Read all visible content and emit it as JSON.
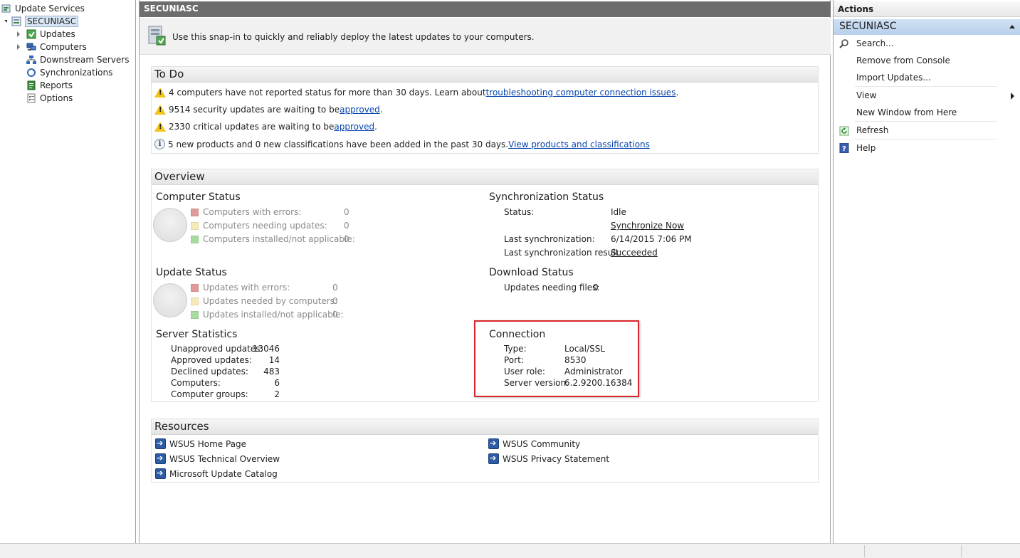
{
  "tree": {
    "root": "Update Services",
    "server": "SECUNIASC",
    "items": [
      {
        "label": "Updates",
        "icon": "updates-icon",
        "expandable": true
      },
      {
        "label": "Computers",
        "icon": "computers-icon",
        "expandable": true
      },
      {
        "label": "Downstream Servers",
        "icon": "downstream-servers-icon",
        "expandable": false
      },
      {
        "label": "Synchronizations",
        "icon": "synchronizations-icon",
        "expandable": false
      },
      {
        "label": "Reports",
        "icon": "reports-icon",
        "expandable": false
      },
      {
        "label": "Options",
        "icon": "options-icon",
        "expandable": false
      }
    ]
  },
  "center": {
    "header": "SECUNIASC",
    "banner": "Use this snap-in to quickly and reliably deploy the latest updates to your computers.",
    "todo": {
      "title": "To Do",
      "items": [
        {
          "text": "4 computers have not reported status for more than 30 days. Learn about ",
          "link": "troubleshooting computer connection issues",
          "suffix": ".",
          "icon": "warning-icon"
        },
        {
          "text": "9514 security updates are waiting to be ",
          "link": "approved",
          "suffix": ".",
          "icon": "warning-icon"
        },
        {
          "text": "2330 critical updates are waiting to be ",
          "link": "approved",
          "suffix": ".",
          "icon": "warning-icon"
        },
        {
          "text": "5 new products and 0 new classifications have been added in the past 30 days. ",
          "link": "View products and classifications",
          "suffix": "",
          "icon": "info-icon"
        }
      ]
    },
    "overview": {
      "title": "Overview",
      "computer_status": {
        "title": "Computer Status",
        "rows": [
          {
            "label": "Computers with errors:",
            "value": "0",
            "color": "#e09a9a"
          },
          {
            "label": "Computers needing updates:",
            "value": "0",
            "color": "#f5eab8"
          },
          {
            "label": "Computers installed/not applicable:",
            "value": "0",
            "color": "#a8dba0"
          }
        ]
      },
      "update_status": {
        "title": "Update Status",
        "rows": [
          {
            "label": "Updates with errors:",
            "value": "0",
            "color": "#e09a9a"
          },
          {
            "label": "Updates needed by computers:",
            "value": "0",
            "color": "#f5eab8"
          },
          {
            "label": "Updates installed/not applicable:",
            "value": "0",
            "color": "#a8dba0"
          }
        ]
      },
      "server_statistics": {
        "title": "Server Statistics",
        "rows": [
          {
            "label": "Unapproved updates:",
            "value": "13046"
          },
          {
            "label": "Approved updates:",
            "value": "14"
          },
          {
            "label": "Declined updates:",
            "value": "483"
          },
          {
            "label": "Computers:",
            "value": "6"
          },
          {
            "label": "Computer groups:",
            "value": "2"
          }
        ]
      },
      "sync_status": {
        "title": "Synchronization Status",
        "status_label": "Status:",
        "status_value": "Idle",
        "sync_now": "Synchronize Now",
        "last_sync_label": "Last synchronization:",
        "last_sync_value": "6/14/2015 7:06 PM",
        "last_result_label": "Last synchronization result:",
        "last_result_value": "Succeeded"
      },
      "download_status": {
        "title": "Download Status",
        "label": "Updates needing files:",
        "value": "0"
      },
      "connection": {
        "title": "Connection",
        "rows": [
          {
            "label": "Type:",
            "value": "Local/SSL"
          },
          {
            "label": "Port:",
            "value": "8530"
          },
          {
            "label": "User role:",
            "value": "Administrator"
          },
          {
            "label": "Server version:",
            "value": "6.2.9200.16384"
          }
        ]
      }
    },
    "resources": {
      "title": "Resources",
      "links": [
        "WSUS Home Page",
        "WSUS Technical Overview",
        "Microsoft Update Catalog",
        "WSUS Community",
        "WSUS Privacy Statement"
      ]
    }
  },
  "actions": {
    "header": "Actions",
    "group": "SECUNIASC",
    "items": {
      "search": "Search...",
      "remove": "Remove from Console",
      "import": "Import Updates...",
      "view": "View",
      "new_window": "New Window from Here",
      "refresh": "Refresh",
      "help": "Help"
    }
  }
}
